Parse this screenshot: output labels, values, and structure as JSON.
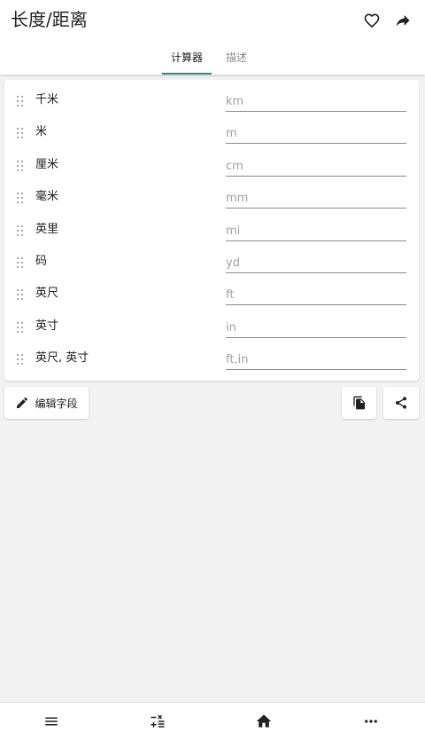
{
  "app": {
    "title": "长度/距离"
  },
  "tabs": [
    {
      "label": "计算器",
      "active": true
    },
    {
      "label": "描述",
      "active": false
    }
  ],
  "units": [
    {
      "label": "千米",
      "placeholder": "km"
    },
    {
      "label": "米",
      "placeholder": "m"
    },
    {
      "label": "厘米",
      "placeholder": "cm"
    },
    {
      "label": "毫米",
      "placeholder": "mm"
    },
    {
      "label": "英里",
      "placeholder": "mi"
    },
    {
      "label": "码",
      "placeholder": "yd"
    },
    {
      "label": "英尺",
      "placeholder": "ft"
    },
    {
      "label": "英寸",
      "placeholder": "in"
    },
    {
      "label": "英尺, 英寸",
      "placeholder": "ft,in"
    }
  ],
  "actions": {
    "edit_fields_label": "编辑字段"
  },
  "colors": {
    "accent": "#2e8b7a",
    "background": "#f2f2f2",
    "surface": "#ffffff"
  },
  "icons": {
    "favorite": "heart-outline-icon",
    "share_top": "share-arrow-icon",
    "edit": "pencil-icon",
    "copy": "copy-icon",
    "share": "share-icon",
    "menu": "hamburger-menu-icon",
    "calculator": "calculator-ops-icon",
    "home": "home-icon",
    "more": "more-horizontal-icon"
  }
}
